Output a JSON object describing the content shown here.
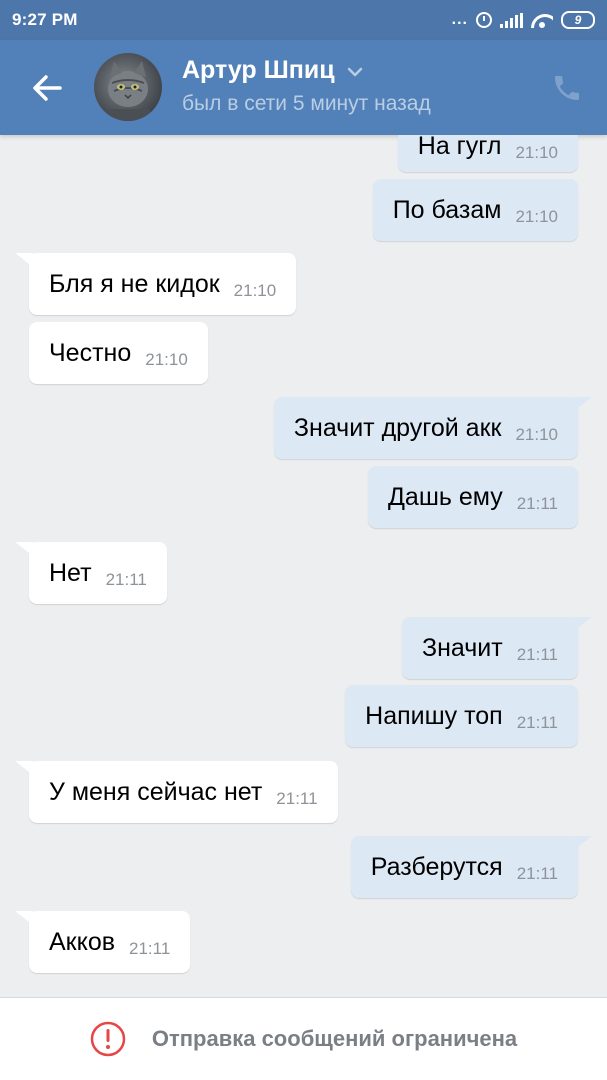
{
  "status_bar": {
    "time": "9:27 PM",
    "dots": "...",
    "battery": "9"
  },
  "header": {
    "contact_name": "Артур Шпиц",
    "contact_status": "был в сети 5 минут назад"
  },
  "messages": [
    {
      "direction": "out",
      "text": "На гугл",
      "time": "21:10"
    },
    {
      "direction": "out",
      "text": "По базам",
      "time": "21:10"
    },
    {
      "direction": "in",
      "text": "Бля я не кидок",
      "time": "21:10"
    },
    {
      "direction": "in",
      "text": "Честно",
      "time": "21:10"
    },
    {
      "direction": "out",
      "text": "Значит другой акк",
      "time": "21:10"
    },
    {
      "direction": "out",
      "text": "Дашь ему",
      "time": "21:11"
    },
    {
      "direction": "in",
      "text": "Нет",
      "time": "21:11"
    },
    {
      "direction": "out",
      "text": "Значит",
      "time": "21:11"
    },
    {
      "direction": "out",
      "text": "Напишу топ",
      "time": "21:11"
    },
    {
      "direction": "in",
      "text": "У меня сейчас нет",
      "time": "21:11"
    },
    {
      "direction": "out",
      "text": "Разберутся",
      "time": "21:11"
    },
    {
      "direction": "in",
      "text": "Акков",
      "time": "21:11"
    }
  ],
  "footer": {
    "notice": "Отправка сообщений ограничена"
  },
  "colors": {
    "header": "#5181b8",
    "status_bar": "#4d77ab",
    "chat_background": "#edeef0",
    "incoming_bubble": "#ffffff",
    "outgoing_bubble": "#dde8f5",
    "warning_red": "#e64646"
  },
  "icons": [
    "back-arrow-icon",
    "chevron-down-icon",
    "phone-icon",
    "alarm-icon",
    "signal-icon",
    "wifi-icon",
    "battery-icon",
    "warning-icon"
  ]
}
